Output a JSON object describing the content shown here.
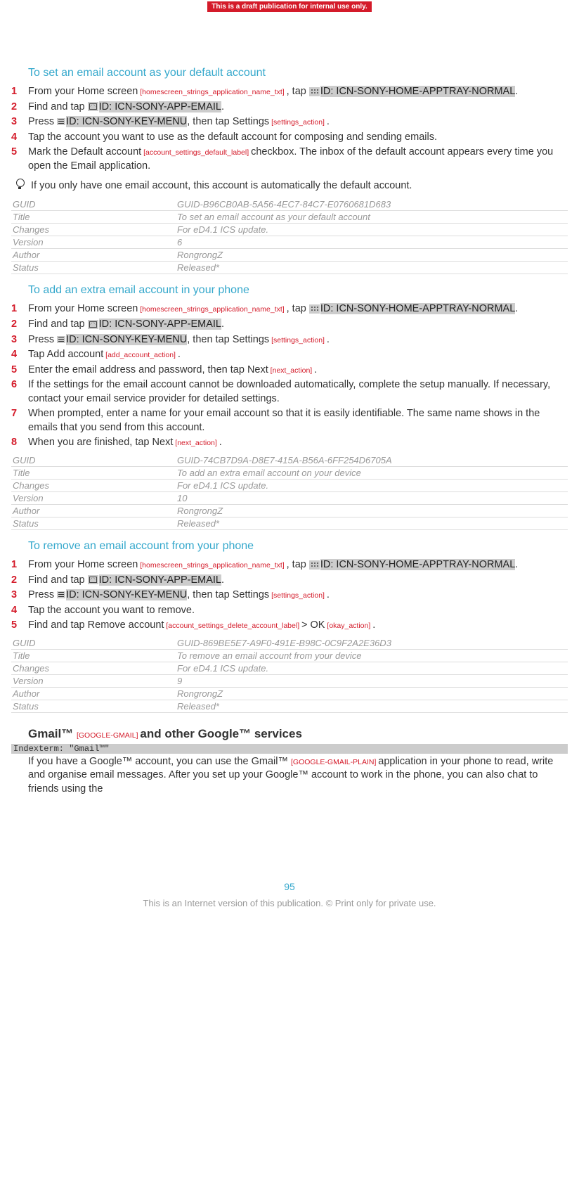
{
  "banner": "This is a draft publication for internal use only.",
  "sections": [
    {
      "title": "To set an email account as your default account",
      "steps": [
        {
          "n": "1",
          "parts": [
            "From your ",
            {
              "b": "Home screen"
            },
            {
              "t": " [homescreen_strings_application_name_txt] "
            },
            ", tap ",
            {
              "icon": "grid"
            },
            {
              "h": "ID: ICN-SONY-HOME-APPTRAY-NORMAL"
            },
            "."
          ]
        },
        {
          "n": "2",
          "parts": [
            "Find and tap ",
            {
              "icon": "envelope"
            },
            {
              "h": "ID: ICN-SONY-APP-EMAIL"
            },
            "."
          ]
        },
        {
          "n": "3",
          "parts": [
            "Press ",
            {
              "icon": "menu"
            },
            {
              "h": "ID: ICN-SONY-KEY-MENU"
            },
            ", then tap ",
            {
              "b": "Settings"
            },
            {
              "t": " [settings_action] "
            },
            "."
          ]
        },
        {
          "n": "4",
          "parts": [
            "Tap the account you want to use as the default account for composing and sending emails."
          ]
        },
        {
          "n": "5",
          "parts": [
            "Mark the ",
            {
              "b": "Default account"
            },
            {
              "t": " [account_settings_default_label] "
            },
            "checkbox. The inbox of the default account appears every time you open the Email application."
          ]
        }
      ],
      "tip": "If you only have one email account, this account is automatically the default account.",
      "meta": {
        "GUID": "GUID-B96CB0AB-5A56-4EC7-84C7-E0760681D683",
        "Title": "To set an email account as your default account",
        "Changes": "For eD4.1 ICS update.",
        "Version": "6",
        "Author": "RongrongZ",
        "Status": "Released*"
      }
    },
    {
      "title": "To add an extra email account in your phone",
      "steps": [
        {
          "n": "1",
          "parts": [
            "From your ",
            {
              "b": "Home screen"
            },
            {
              "t": " [homescreen_strings_application_name_txt] "
            },
            ", tap ",
            {
              "icon": "grid"
            },
            {
              "h": "ID: ICN-SONY-HOME-APPTRAY-NORMAL"
            },
            "."
          ]
        },
        {
          "n": "2",
          "parts": [
            "Find and tap ",
            {
              "icon": "envelope"
            },
            {
              "h": "ID: ICN-SONY-APP-EMAIL"
            },
            "."
          ]
        },
        {
          "n": "3",
          "parts": [
            "Press ",
            {
              "icon": "menu"
            },
            {
              "h": "ID: ICN-SONY-KEY-MENU"
            },
            ", then tap ",
            {
              "b": "Settings"
            },
            {
              "t": " [settings_action] "
            },
            "."
          ]
        },
        {
          "n": "4",
          "parts": [
            "Tap ",
            {
              "b": "Add account"
            },
            {
              "t": " [add_account_action] "
            },
            "."
          ]
        },
        {
          "n": "5",
          "parts": [
            "Enter the email address and password, then tap ",
            {
              "b": "Next"
            },
            {
              "t": " [next_action] "
            },
            "."
          ]
        },
        {
          "n": "6",
          "parts": [
            "If the settings for the email account cannot be downloaded automatically, complete the setup manually. If necessary, contact your email service provider for detailed settings."
          ]
        },
        {
          "n": "7",
          "parts": [
            "When prompted, enter a name for your email account so that it is easily identifiable. The same name shows in the emails that you send from this account."
          ]
        },
        {
          "n": "8",
          "parts": [
            "When you are finished, tap ",
            {
              "b": "Next"
            },
            {
              "t": " [next_action] "
            },
            "."
          ]
        }
      ],
      "meta": {
        "GUID": "GUID-74CB7D9A-D8E7-415A-B56A-6FF254D6705A",
        "Title": "To add an extra email account on your device",
        "Changes": "For eD4.1 ICS update.",
        "Version": "10",
        "Author": "RongrongZ",
        "Status": "Released*"
      }
    },
    {
      "title": "To remove an email account from your phone",
      "steps": [
        {
          "n": "1",
          "parts": [
            "From your ",
            {
              "b": "Home screen"
            },
            {
              "t": " [homescreen_strings_application_name_txt] "
            },
            ", tap ",
            {
              "icon": "grid"
            },
            {
              "h": "ID: ICN-SONY-HOME-APPTRAY-NORMAL"
            },
            "."
          ]
        },
        {
          "n": "2",
          "parts": [
            "Find and tap ",
            {
              "icon": "envelope"
            },
            {
              "h": "ID: ICN-SONY-APP-EMAIL"
            },
            "."
          ]
        },
        {
          "n": "3",
          "parts": [
            "Press ",
            {
              "icon": "menu"
            },
            {
              "h": "ID: ICN-SONY-KEY-MENU"
            },
            ", then tap ",
            {
              "b": "Settings"
            },
            {
              "t": " [settings_action] "
            },
            "."
          ]
        },
        {
          "n": "4",
          "parts": [
            "Tap the account you want to remove."
          ]
        },
        {
          "n": "5",
          "parts": [
            "Find and tap ",
            {
              "b": "Remove account"
            },
            {
              "t": " [account_settings_delete_account_label] "
            },
            "> ",
            {
              "b": "OK"
            },
            {
              "t": " [okay_action] "
            },
            "."
          ]
        }
      ],
      "meta": {
        "GUID": "GUID-869BE5E7-A9F0-491E-B98C-0C9F2A2E36D3",
        "Title": "To remove an email account from your device",
        "Changes": "For eD4.1 ICS update.",
        "Version": "9",
        "Author": "RongrongZ",
        "Status": "Released*"
      }
    }
  ],
  "gmail": {
    "heading_parts": [
      "Gmail™ ",
      {
        "t": "[GOOGLE-GMAIL] "
      },
      "and other Google™ services"
    ],
    "indexterm": "Indexterm: \"Gmail™\"",
    "paragraph_parts": [
      "If you have a Google™ account, you can use the ",
      {
        "b": "Gmail™ "
      },
      {
        "t": "[GOOGLE-GMAIL-PLAIN] "
      },
      "application in your phone to read, write and organise email messages. After you set up your Google™ account to work in the phone, you can also chat to friends using the"
    ]
  },
  "page_num": "95",
  "footer": "This is an Internet version of this publication. © Print only for private use."
}
